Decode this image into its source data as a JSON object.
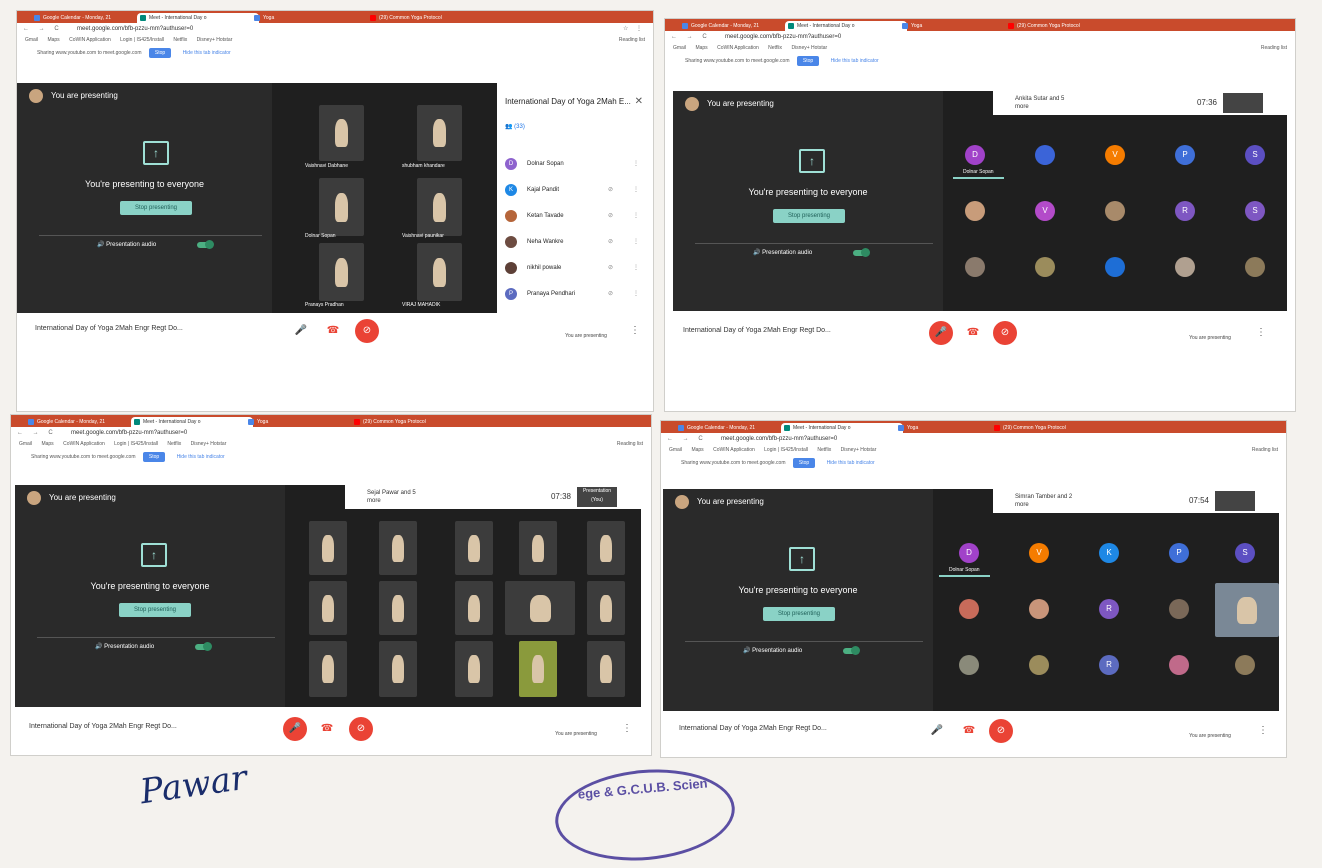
{
  "browser": {
    "tabs": [
      "Google Calendar - Monday, 21",
      "Meet - International Day o",
      "Yoga",
      "(29) Common Yoga Protocol"
    ],
    "url": "meet.google.com/bfb-pzzu-mm?authuser=0",
    "bookmarks": [
      "Gmail",
      "Maps",
      "CoWIN Application",
      "Login | IS425/Install",
      "Netflix",
      "Disney+ Hotstar"
    ],
    "reading_list": "Reading list",
    "sharing_text": "Sharing www.youtube.com to meet.google.com",
    "stop_label": "Stop",
    "hide_label": "Hide this tab indicator"
  },
  "meet": {
    "you_are_presenting": "You are presenting",
    "presenting_to_everyone": "You're presenting to everyone",
    "stop_presenting": "Stop presenting",
    "presentation_audio": "Presentation audio",
    "meeting_title": "International Day of Yoga 2Mah Engr Regt Do...",
    "you_are_presenting_short": "You are presenting",
    "clock_q3": "07:38",
    "clock_q4": "07:54",
    "clock_q2": "07:36",
    "q2_pinned": "Ankita Sutar and 5 more",
    "q3_pinned": "Sejal Pawar and 5 more",
    "q4_pinned": "Simran Tamber and 2 more",
    "presentation_you": "Presentation (You)",
    "you": "You",
    "dolnar_sopan": "Dolnar Sopan"
  },
  "panel": {
    "title": "International Day of Yoga 2Mah E...",
    "people_count": "(33)",
    "participants": [
      {
        "initial": "D",
        "name": "Dolnar Sopan",
        "color": "#8e63ce"
      },
      {
        "initial": "K",
        "name": "Kajal Pandit",
        "color": "#1e88e5"
      },
      {
        "initial": "",
        "name": "Ketan Tavade",
        "color": "#b5653a"
      },
      {
        "initial": "",
        "name": "Neha Wankre",
        "color": "#6d4c41"
      },
      {
        "initial": "",
        "name": "nikhil powale",
        "color": "#5d4037"
      },
      {
        "initial": "P",
        "name": "Pranaya Pendhari",
        "color": "#5c6bc0"
      }
    ]
  },
  "q1_tiles": [
    "Vaishnavi Dabhane",
    "shubham khandare",
    "Dolnar Sopan",
    "Vaishnavi paunikar",
    "Pranays Pradhan",
    "VIRAJ MAHADIK"
  ],
  "q2_circles": [
    {
      "t": "D",
      "c": "#a142c9"
    },
    {
      "t": "",
      "c": "#3b64d8"
    },
    {
      "t": "V",
      "c": "#f57c00"
    },
    {
      "t": "P",
      "c": "#3f6fd8"
    },
    {
      "t": "S",
      "c": "#5c4fc2"
    },
    {
      "t": "",
      "c": "#c89c7a"
    },
    {
      "t": "V",
      "c": "#b34bc9"
    },
    {
      "t": "",
      "c": "#a88a6a"
    },
    {
      "t": "R",
      "c": "#7e57c2"
    },
    {
      "t": "S",
      "c": "#7e57c2"
    },
    {
      "t": "",
      "c": "#8a7a6c"
    },
    {
      "t": "",
      "c": "#9b8c5c"
    },
    {
      "t": "",
      "c": "#1e6ed6"
    },
    {
      "t": "",
      "c": "#b0a090"
    },
    {
      "t": "",
      "c": "#8c7a5a"
    }
  ],
  "q4_circles": [
    {
      "t": "D",
      "c": "#a142c9"
    },
    {
      "t": "V",
      "c": "#f57c00"
    },
    {
      "t": "K",
      "c": "#1e88e5"
    },
    {
      "t": "P",
      "c": "#3f6fd8"
    },
    {
      "t": "S",
      "c": "#5c4fc2"
    },
    {
      "t": "",
      "c": "#c86b5a"
    },
    {
      "t": "",
      "c": "#c9957a"
    },
    {
      "t": "R",
      "c": "#7e57c2"
    },
    {
      "t": "",
      "c": "#7a6858"
    },
    {
      "t": "",
      "c": "#b0a090"
    },
    {
      "t": "",
      "c": "#8a8a7a"
    },
    {
      "t": "",
      "c": "#9b8c5c"
    },
    {
      "t": "R",
      "c": "#5c6bc0"
    },
    {
      "t": "",
      "c": "#c06a8a"
    },
    {
      "t": "",
      "c": "#8c7a5a"
    }
  ],
  "signature": "Pawar",
  "stamp_text": "ege & G.C.U.B. Scien"
}
